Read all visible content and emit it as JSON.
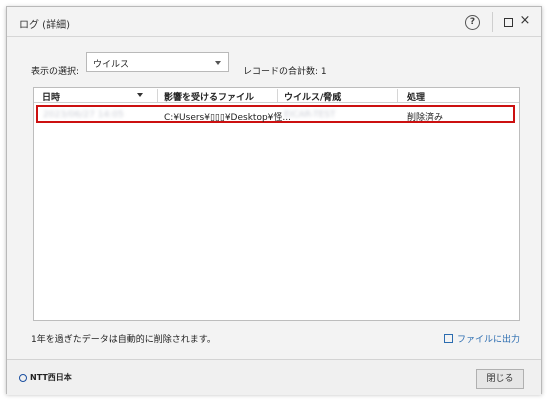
{
  "window": {
    "title": "ログ (詳細)"
  },
  "titlebar": {
    "help_glyph": "?",
    "close_glyph": "×"
  },
  "filter": {
    "label": "表示の選択:",
    "selected": "ウイルス",
    "record_count": "レコードの合計数: 1"
  },
  "table": {
    "headers": [
      "日時",
      "影響を受けるファイル",
      "ウイルス/脅威",
      "処理"
    ],
    "rows": [
      {
        "datetime": "2023/06/27 14:05",
        "file": "C:¥Users¥▯▯▯¥Desktop¥怪...",
        "threat": "EICAR-TEST",
        "action": "削除済み"
      }
    ]
  },
  "notice": "1年を過ぎたデータは自動的に削除されます。",
  "export_label": "ファイルに出力",
  "footer": {
    "brand": "NTT西日本",
    "close_label": "閉じる"
  }
}
